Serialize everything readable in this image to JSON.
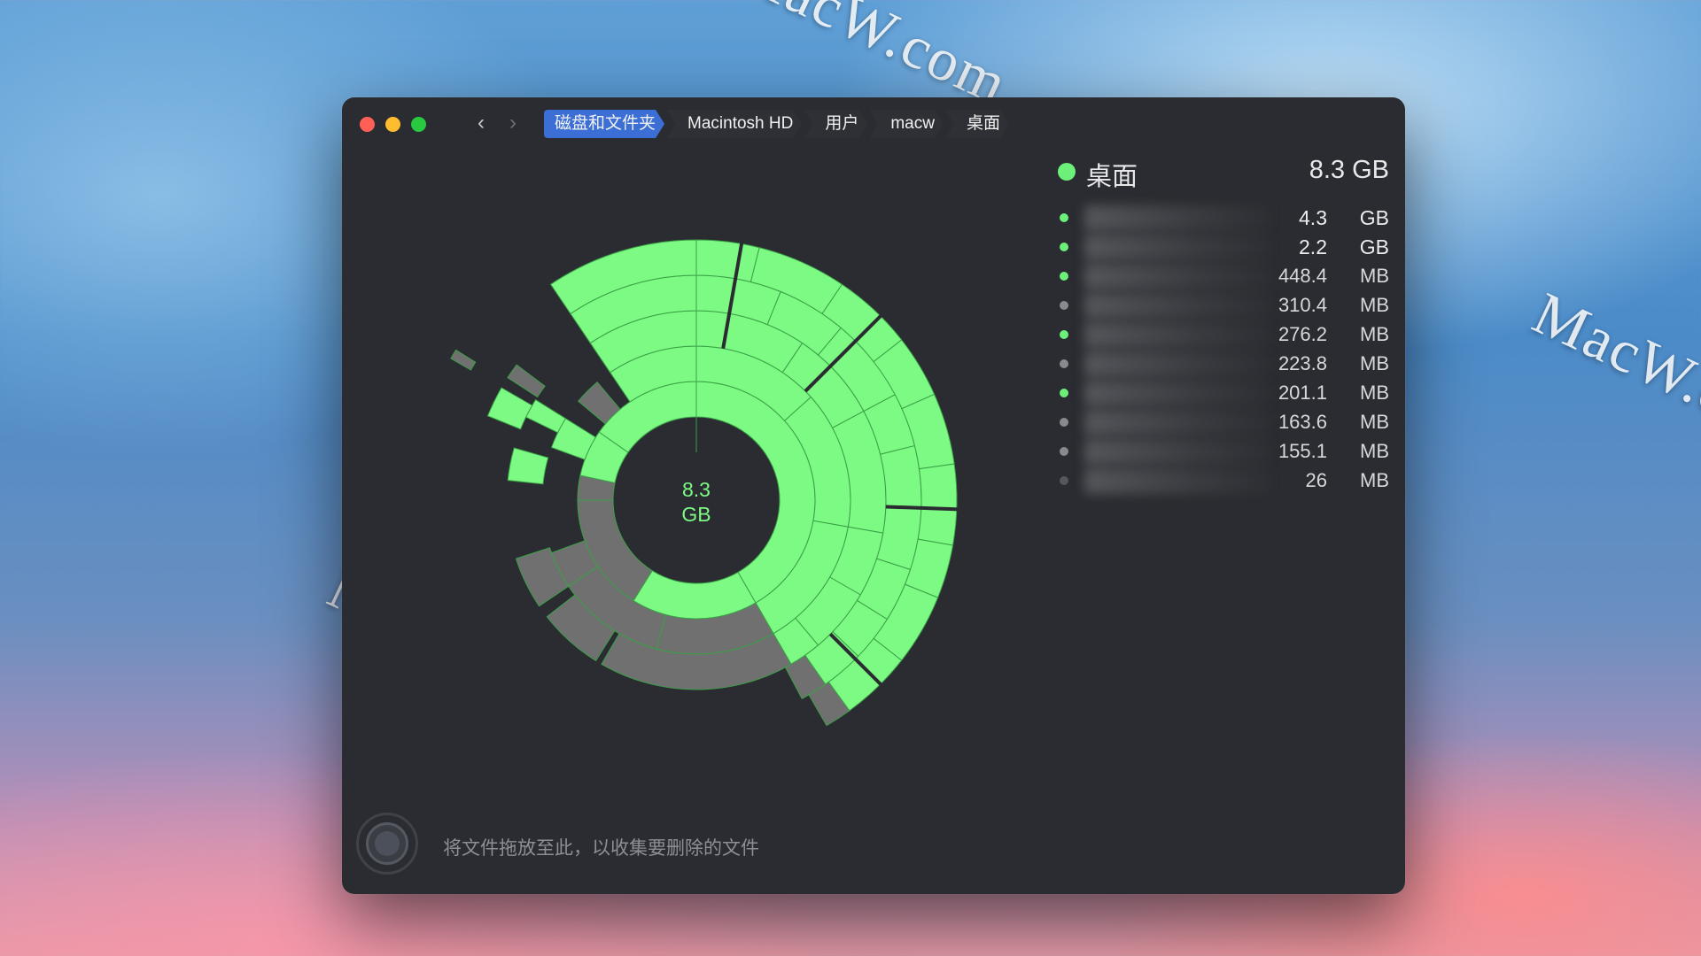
{
  "watermark": "MacW.com",
  "breadcrumb": [
    "磁盘和文件夹",
    "Macintosh HD",
    "用户",
    "macw",
    "桌面"
  ],
  "nav": {
    "back_icon": "chevron-left-icon",
    "forward_icon": "chevron-right-icon"
  },
  "center_label": {
    "value": "8.3",
    "unit": "GB"
  },
  "panel": {
    "title": "桌面",
    "total": "8.3 GB",
    "items": [
      {
        "value": "4.3",
        "unit": "GB",
        "color": "#6cf07a"
      },
      {
        "value": "2.2",
        "unit": "GB",
        "color": "#6cf07a"
      },
      {
        "value": "448.4",
        "unit": "MB",
        "color": "#6cf07a"
      },
      {
        "value": "310.4",
        "unit": "MB",
        "color": "#8a8a8e"
      },
      {
        "value": "276.2",
        "unit": "MB",
        "color": "#6cf07a"
      },
      {
        "value": "223.8",
        "unit": "MB",
        "color": "#8a8a8e"
      },
      {
        "value": "201.1",
        "unit": "MB",
        "color": "#6cf07a"
      },
      {
        "value": "163.6",
        "unit": "MB",
        "color": "#8a8a8e"
      },
      {
        "value": "155.1",
        "unit": "MB",
        "color": "#8a8a8e"
      },
      {
        "value": "26",
        "unit": "MB",
        "color": "#55575c"
      }
    ]
  },
  "drop_hint": "将文件拖放至此，以收集要删除的文件",
  "colors": {
    "green": "#7cfa83",
    "grey": "#707070",
    "window_bg": "#2a2c31",
    "accent": "#3c6fd6"
  }
}
